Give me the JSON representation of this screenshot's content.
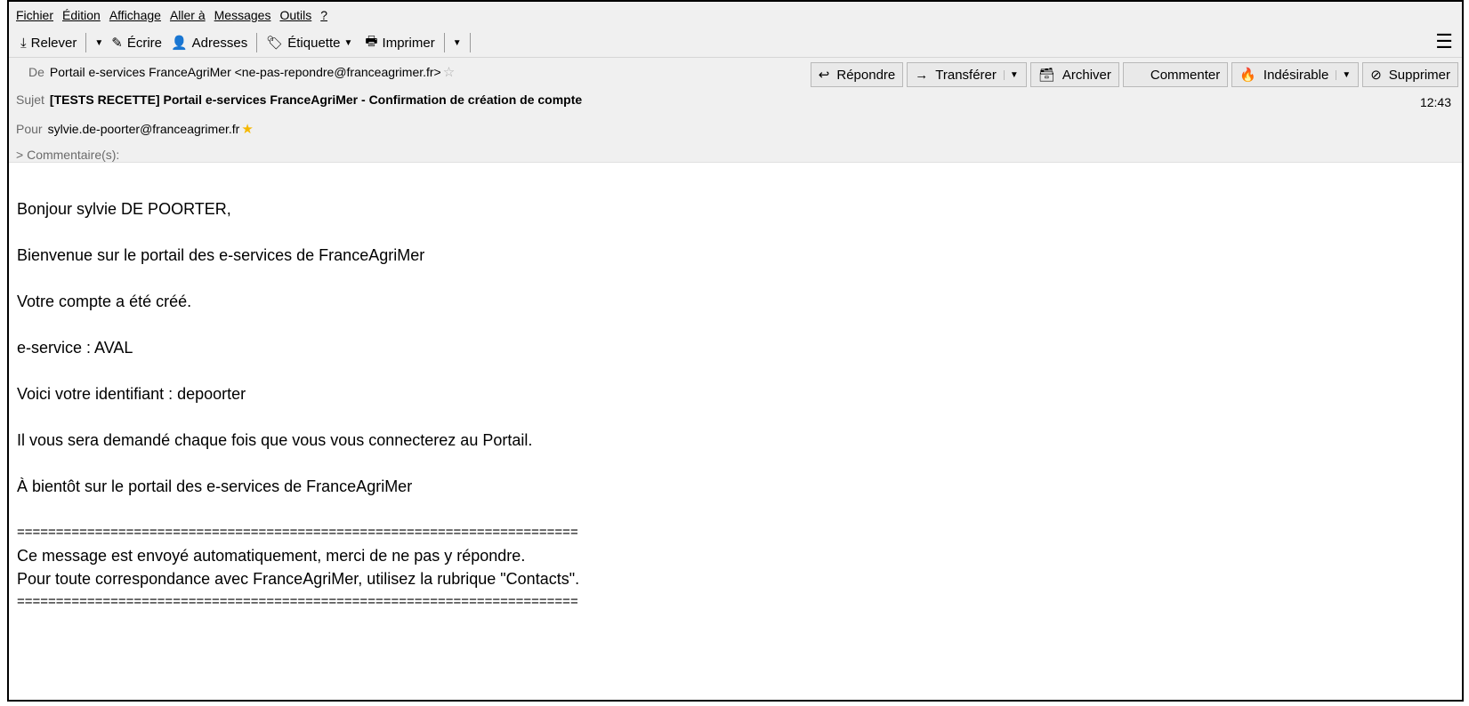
{
  "menubar": {
    "items": [
      "Fichier",
      "Édition",
      "Affichage",
      "Aller à",
      "Messages",
      "Outils",
      "?"
    ]
  },
  "toolbar": {
    "relever": "Relever",
    "ecrire": "Écrire",
    "adresses": "Adresses",
    "etiquette": "Étiquette",
    "imprimer": "Imprimer"
  },
  "header": {
    "from_label": "De",
    "from_value": "Portail e-services FranceAgriMer <ne-pas-repondre@franceagrimer.fr>",
    "subject_label": "Sujet",
    "subject_value": "[TESTS RECETTE] Portail e-services FranceAgriMer - Confirmation de création de compte",
    "to_label": "Pour",
    "to_value": "sylvie.de-poorter@franceagrimer.fr",
    "time": "12:43",
    "comments": "Commentaire(s):"
  },
  "actions": {
    "repondre": "Répondre",
    "transferer": "Transférer",
    "archiver": "Archiver",
    "commenter": "Commenter",
    "indesirable": "Indésirable",
    "supprimer": "Supprimer"
  },
  "body": {
    "greeting": "Bonjour sylvie DE POORTER,",
    "welcome": "Bienvenue sur le portail des e-services de FranceAgriMer",
    "created": "Votre compte a été créé.",
    "service": "e-service : AVAL",
    "identifiant": "Voici votre identifiant : depoorter",
    "demande": "Il vous sera demandé chaque fois que vous vous connecterez au Portail.",
    "bientot": "À bientôt sur le portail des e-services de FranceAgriMer",
    "separator": "========================================================================",
    "auto": "Ce message est envoyé automatiquement, merci de ne pas y répondre.",
    "contacts": "Pour toute correspondance avec FranceAgriMer, utilisez la rubrique \"Contacts\"."
  }
}
